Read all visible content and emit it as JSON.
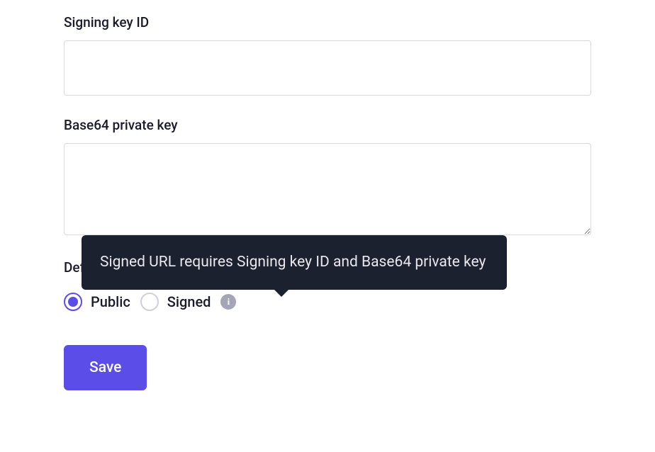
{
  "fields": {
    "signing_key_id": {
      "label": "Signing key ID",
      "value": ""
    },
    "base64_private_key": {
      "label": "Base64 private key",
      "value": ""
    }
  },
  "url_type": {
    "label": "Default URL type",
    "options": {
      "public": {
        "label": "Public",
        "selected": true
      },
      "signed": {
        "label": "Signed",
        "selected": false
      }
    },
    "tooltip": "Signed URL requires Signing key ID and Base64 private key"
  },
  "actions": {
    "save_label": "Save"
  }
}
